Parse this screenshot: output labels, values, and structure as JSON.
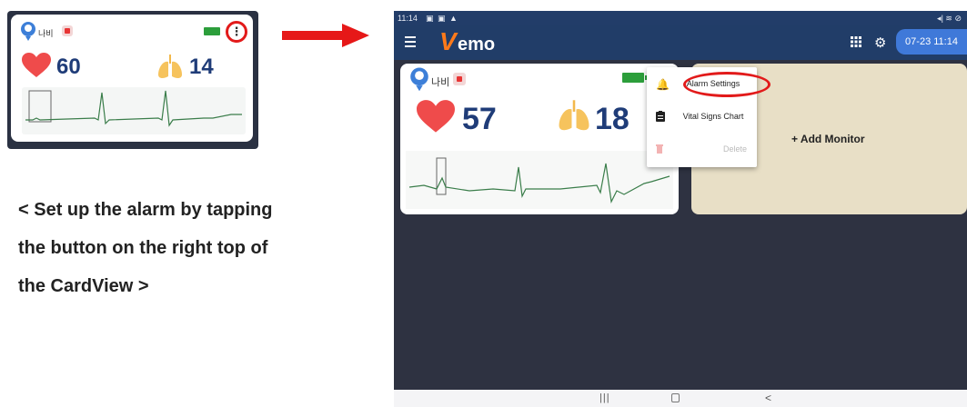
{
  "thumbnail": {
    "patient_name": "나비",
    "kebab_label": "⋮",
    "heart_rate": "60",
    "respiration_rate": "14"
  },
  "caption": {
    "line1": "< Set up the alarm by tapping",
    "line2": "the button on the right top of",
    "line3": "the CardView >"
  },
  "tablet": {
    "status": {
      "time": "11:14",
      "left_icons": "▣ ▣ ▲",
      "right_icons": "◂| ≋ ⊘"
    },
    "appbar": {
      "logo_letter": "V",
      "logo_rest": "emo",
      "datetime": "07-23 11:14"
    },
    "card": {
      "patient_name": "나비",
      "heart_rate": "57",
      "respiration_rate": "18"
    },
    "popup": {
      "items": [
        {
          "label": "Alarm Settings"
        },
        {
          "label": "Vital Signs Chart"
        },
        {
          "label": "Delete"
        }
      ]
    },
    "add_monitor": "+ Add Monitor",
    "navbar": {
      "recent": "|||",
      "back": "<"
    }
  },
  "colors": {
    "appbar": "#213d68",
    "accent": "#3f79d9",
    "logo": "#ff7a1a",
    "vital_value": "#1f3c78",
    "highlight": "#e21a1a",
    "battery": "#2c9e3b"
  },
  "icons": [
    "avatar-icon",
    "record-icon",
    "battery-icon",
    "kebab-menu-icon",
    "heart-icon",
    "lungs-icon",
    "menu-icon",
    "grid-icon",
    "gear-icon",
    "bell-icon",
    "clipboard-icon",
    "trash-icon",
    "arrow-right-icon"
  ]
}
